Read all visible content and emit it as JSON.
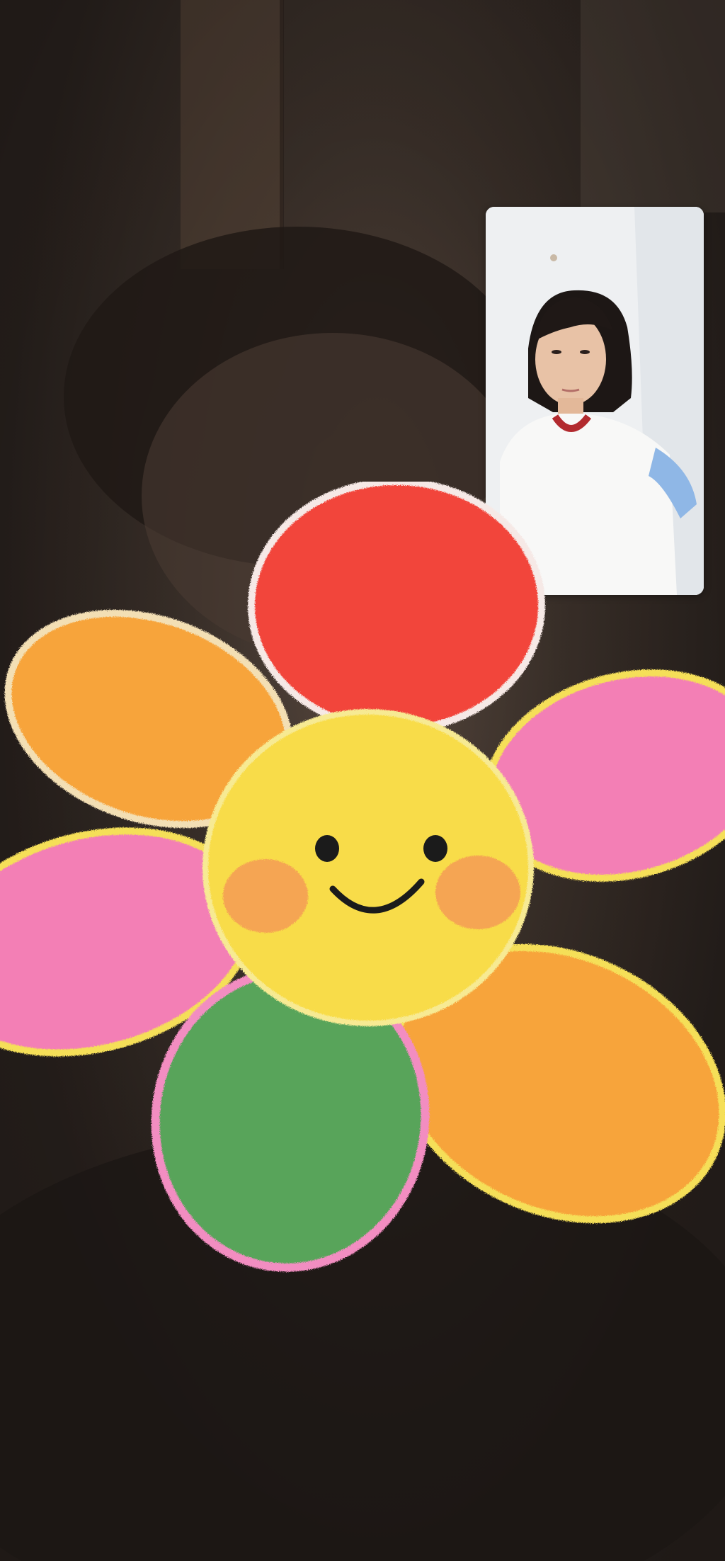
{
  "call": {
    "remote_video": {
      "icon": "video-feed-icon"
    },
    "self_view": {
      "icon": "self-view-icon"
    },
    "effect_sticker": {
      "icon": "smiling-flower-sticker-icon",
      "colors": {
        "petal_red": "#f2453b",
        "petal_orange": "#f7a43a",
        "petal_pink": "#f37fb5",
        "petal_green": "#58a45a",
        "face_yellow": "#f8dc4a",
        "cheek": "#f59b54"
      }
    }
  }
}
